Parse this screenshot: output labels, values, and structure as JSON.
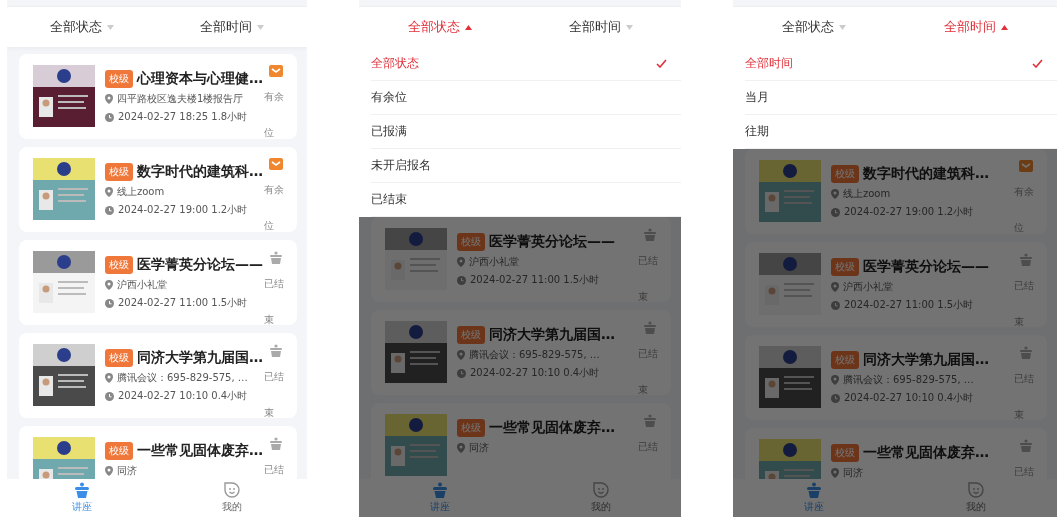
{
  "screens": [
    {
      "filters": [
        {
          "label": "全部状态",
          "expanded": false
        },
        {
          "label": "全部时间",
          "expanded": false
        }
      ],
      "cards": [
        {
          "badge": "校级",
          "title": "心理资本与心理健…",
          "location": "四平路校区逸夫楼1楼报告厅",
          "time": "2024-02-27 18:25 1.8小时",
          "status": "有余位",
          "kind": "open"
        },
        {
          "badge": "校级",
          "title": "数字时代的建筑科…",
          "location": "线上zoom",
          "time": "2024-02-27 19:00 1.2小时",
          "status": "有余位",
          "kind": "open"
        },
        {
          "badge": "校级",
          "title": "医学菁英分论坛——",
          "location": "沪西小礼堂",
          "time": "2024-02-27 11:00 1.5小时",
          "status": "已结束",
          "kind": "ended"
        },
        {
          "badge": "校级",
          "title": "同济大学第九届国…",
          "location": "腾讯会议：695-829-575, …",
          "time": "2024-02-27 10:10 0.4小时",
          "status": "已结束",
          "kind": "ended"
        },
        {
          "badge": "校级",
          "title": "一些常见固体废弃…",
          "location": "同济",
          "status": "已结",
          "kind": "ended"
        }
      ],
      "tabs": [
        {
          "label": "讲座",
          "selected": true
        },
        {
          "label": "我的",
          "selected": false
        }
      ]
    },
    {
      "filters": [
        {
          "label": "全部状态",
          "expanded": true
        },
        {
          "label": "全部时间",
          "expanded": false
        }
      ],
      "dropdown": [
        {
          "label": "全部状态",
          "selected": true
        },
        {
          "label": "有余位",
          "selected": false
        },
        {
          "label": "已报满",
          "selected": false
        },
        {
          "label": "未开启报名",
          "selected": false
        },
        {
          "label": "已结束",
          "selected": false
        }
      ],
      "cards": [
        {
          "badge": "校级",
          "title": "医学菁英分论坛——",
          "location": "沪西小礼堂",
          "time": "2024-02-27 11:00 1.5小时",
          "status": "已结束",
          "kind": "ended"
        },
        {
          "badge": "校级",
          "title": "同济大学第九届国…",
          "location": "腾讯会议：695-829-575, …",
          "time": "2024-02-27 10:10 0.4小时",
          "status": "已结束",
          "kind": "ended"
        },
        {
          "badge": "校级",
          "title": "一些常见固体废弃…",
          "location": "同济",
          "status": "已结",
          "kind": "ended"
        }
      ],
      "tabs": [
        {
          "label": "讲座",
          "selected": true
        },
        {
          "label": "我的",
          "selected": false
        }
      ]
    },
    {
      "filters": [
        {
          "label": "全部状态",
          "expanded": false
        },
        {
          "label": "全部时间",
          "expanded": true
        }
      ],
      "dropdown": [
        {
          "label": "全部时间",
          "selected": true
        },
        {
          "label": "当月",
          "selected": false
        },
        {
          "label": "往期",
          "selected": false
        }
      ],
      "cards": [
        {
          "badge": "校级",
          "title": "数字时代的建筑科…",
          "location": "线上zoom",
          "time": "2024-02-27 19:00 1.2小时",
          "status": "有余位",
          "kind": "open"
        },
        {
          "badge": "校级",
          "title": "医学菁英分论坛——",
          "location": "沪西小礼堂",
          "time": "2024-02-27 11:00 1.5小时",
          "status": "已结束",
          "kind": "ended"
        },
        {
          "badge": "校级",
          "title": "同济大学第九届国…",
          "location": "腾讯会议：695-829-575, …",
          "time": "2024-02-27 10:10 0.4小时",
          "status": "已结束",
          "kind": "ended"
        },
        {
          "badge": "校级",
          "title": "一些常见固体废弃…",
          "location": "同济",
          "status": "已结",
          "kind": "ended"
        }
      ],
      "tabs": [
        {
          "label": "讲座",
          "selected": true
        },
        {
          "label": "我的",
          "selected": false
        }
      ]
    }
  ]
}
